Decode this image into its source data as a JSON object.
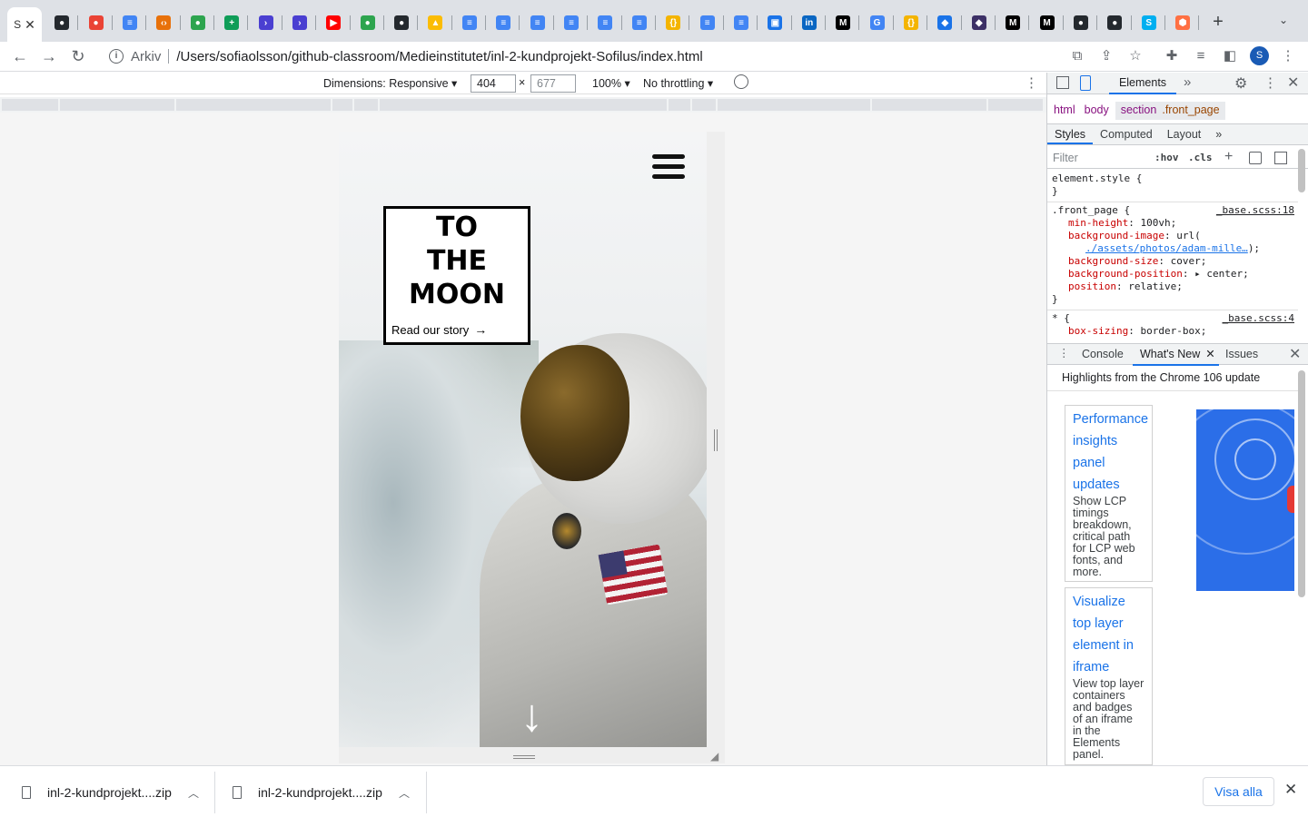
{
  "browser": {
    "active_tab_label": "S",
    "tab_icons": [
      {
        "icon": "github-icon",
        "color": "#24292e",
        "glyph": "●"
      },
      {
        "icon": "maps-pin-icon",
        "color": "#ea4335",
        "glyph": "●"
      },
      {
        "icon": "docs-icon",
        "color": "#4285f4",
        "glyph": "≡"
      },
      {
        "icon": "code-icon",
        "color": "#e8710a",
        "glyph": "‹›"
      },
      {
        "icon": "github-green-icon",
        "color": "#2da44e",
        "glyph": "●"
      },
      {
        "icon": "sheets-icon",
        "color": "#0f9d58",
        "glyph": "+"
      },
      {
        "icon": "powershell-icon",
        "color": "#4a3fd1",
        "glyph": "›"
      },
      {
        "icon": "powershell-icon",
        "color": "#4a3fd1",
        "glyph": "›"
      },
      {
        "icon": "youtube-icon",
        "color": "#ff0000",
        "glyph": "▶"
      },
      {
        "icon": "github-green-icon",
        "color": "#2da44e",
        "glyph": "●"
      },
      {
        "icon": "github-icon",
        "color": "#24292e",
        "glyph": "●"
      },
      {
        "icon": "drive-icon",
        "color": "#fbbc04",
        "glyph": "▲"
      },
      {
        "icon": "docs-icon",
        "color": "#4285f4",
        "glyph": "≡"
      },
      {
        "icon": "docs-icon",
        "color": "#4285f4",
        "glyph": "≡"
      },
      {
        "icon": "docs-icon",
        "color": "#4285f4",
        "glyph": "≡"
      },
      {
        "icon": "docs-icon",
        "color": "#4285f4",
        "glyph": "≡"
      },
      {
        "icon": "docs-icon",
        "color": "#4285f4",
        "glyph": "≡"
      },
      {
        "icon": "docs-icon",
        "color": "#4285f4",
        "glyph": "≡"
      },
      {
        "icon": "json-icon",
        "color": "#f4b400",
        "glyph": "{}"
      },
      {
        "icon": "docs-icon",
        "color": "#4285f4",
        "glyph": "≡"
      },
      {
        "icon": "docs-icon",
        "color": "#4285f4",
        "glyph": "≡"
      },
      {
        "icon": "translate-icon",
        "color": "#1a73e8",
        "glyph": "▣"
      },
      {
        "icon": "linkedin-icon",
        "color": "#0a66c2",
        "glyph": "in"
      },
      {
        "icon": "medium-icon",
        "color": "#000000",
        "glyph": "M"
      },
      {
        "icon": "google-icon",
        "color": "#4285f4",
        "glyph": "G"
      },
      {
        "icon": "json-icon",
        "color": "#f4b400",
        "glyph": "{}"
      },
      {
        "icon": "eraser-icon",
        "color": "#1a73e8",
        "glyph": "◆"
      },
      {
        "icon": "mask-icon",
        "color": "#3c3066",
        "glyph": "◆"
      },
      {
        "icon": "medium-icon",
        "color": "#000000",
        "glyph": "M"
      },
      {
        "icon": "medium-icon",
        "color": "#000000",
        "glyph": "M"
      },
      {
        "icon": "github-icon",
        "color": "#24292e",
        "glyph": "●"
      },
      {
        "icon": "github-icon",
        "color": "#24292e",
        "glyph": "●"
      },
      {
        "icon": "skype-icon",
        "color": "#00aff0",
        "glyph": "S"
      },
      {
        "icon": "octagon-icon",
        "color": "#ff7043",
        "glyph": "⬢"
      }
    ],
    "scheme_label": "Arkiv",
    "url": "/Users/sofiaolsson/github-classroom/Medieinstitutet/inl-2-kundprojekt-Sofilus/index.html",
    "profile_initial": "S"
  },
  "device_toolbar": {
    "dimensions_label": "Dimensions: Responsive ▾",
    "width": "404",
    "height": "677",
    "times": "×",
    "zoom": "100% ▾",
    "throttling": "No throttling ▾"
  },
  "page": {
    "hero_title": "TO\nTHE\nMOON",
    "hero_link": "Read our story",
    "hero_link_arrow": "→",
    "scroll_arrow": "↓"
  },
  "devtools": {
    "main_tab": "Elements",
    "breadcrumb": {
      "html": "html",
      "body": "body",
      "section_tag": "section",
      "section_class": ".front_page"
    },
    "style_tabs": [
      "Styles",
      "Computed",
      "Layout"
    ],
    "filter_placeholder": "Filter",
    "hov": ":hov",
    "cls": ".cls",
    "element_style_selector": "element.style {",
    "close_brace": "}",
    "rule1": {
      "selector": ".front_page {",
      "source": "_base.scss:18",
      "props": [
        {
          "k": "min-height",
          "v": "100vh;"
        },
        {
          "k": "background-image",
          "v": "url("
        },
        {
          "k": "",
          "link": "./assets/photos/adam-mille…",
          "v": ");"
        },
        {
          "k": "background-size",
          "v": "cover;"
        },
        {
          "k": "background-position",
          "v": "▸ center;"
        },
        {
          "k": "position",
          "v": "relative;"
        }
      ]
    },
    "rule2": {
      "selector": "* {",
      "source": "_base.scss:4",
      "props": [
        {
          "k": "box-sizing",
          "v": "border-box;"
        }
      ]
    },
    "drawer_tabs": {
      "console": "Console",
      "whats_new": "What's New",
      "issues": "Issues"
    },
    "whats_new_heading": "Highlights from the Chrome 106 update",
    "cards": [
      {
        "title": "Performance insights panel updates",
        "desc": "Show LCP timings breakdown, critical path for LCP web fonts, and more."
      },
      {
        "title": "Visualize top layer element in iframe",
        "desc": "View top layer containers and badges of an iframe in the Elements panel."
      }
    ]
  },
  "downloads": {
    "items": [
      "inl-2-kundprojekt....zip",
      "inl-2-kundprojekt....zip"
    ],
    "show_all": "Visa alla"
  }
}
